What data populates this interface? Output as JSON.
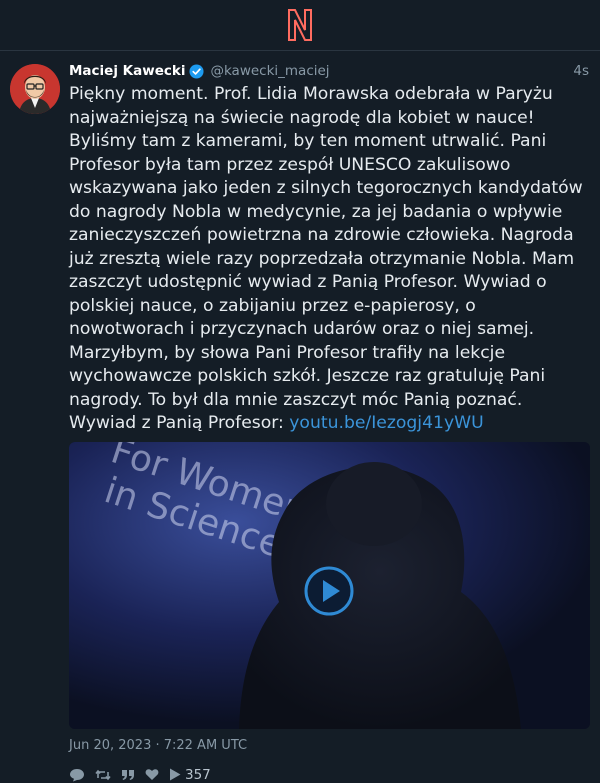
{
  "app": {
    "logo_icon": "nitter-logo",
    "accent_color": "#ff6c60",
    "link_color": "#3b94d9"
  },
  "tweet": {
    "author_name": "Maciej Kawecki",
    "verified_icon": "verified-badge-icon",
    "handle": "@kawecki_maciej",
    "relative_time": "4s",
    "text": "Piękny moment. Prof. Lidia Morawska odebrała w Paryżu najważniejszą na świecie nagrodę dla kobiet w nauce! Byliśmy tam z kamerami, by ten moment utrwalić. Pani Profesor była tam przez zespół UNESCO zakulisowo wskazywana jako jeden z silnych tegorocznych kandydatów do nagrody Nobla w medycynie, za jej badania o wpływie zanieczyszczeń powietrzna na zdrowie człowieka. Nagroda już zresztą wiele razy poprzedzała otrzymanie Nobla. Mam zaszczyt udostępnić wywiad z Panią Profesor. Wywiad o polskiej nauce, o zabijaniu przez e-papierosy, o nowotworach i przyczynach udarów oraz o niej samej. Marzyłbym, by słowa Pani Profesor trafiły na lekcje wychowawcze polskich szkół. Jeszcze raz gratuluję Pani nagrody. To był dla mnie zaszczyt móc Panią poznać. Wywiad z Panią Profesor: ",
    "link_text": "youtu.be/Iezogj41yWU",
    "video": {
      "backdrop_text_line1": "For Women",
      "backdrop_text_line2": "in Science",
      "play_icon": "play-circle-icon"
    },
    "date": "Jun 20, 2023 · 7:22 AM UTC",
    "actions": {
      "reply_icon": "comment-icon",
      "retweet_icon": "retweet-icon",
      "quote_icon": "quote-icon",
      "like_icon": "heart-icon",
      "views_icon": "play-icon",
      "views_count": "357"
    }
  }
}
